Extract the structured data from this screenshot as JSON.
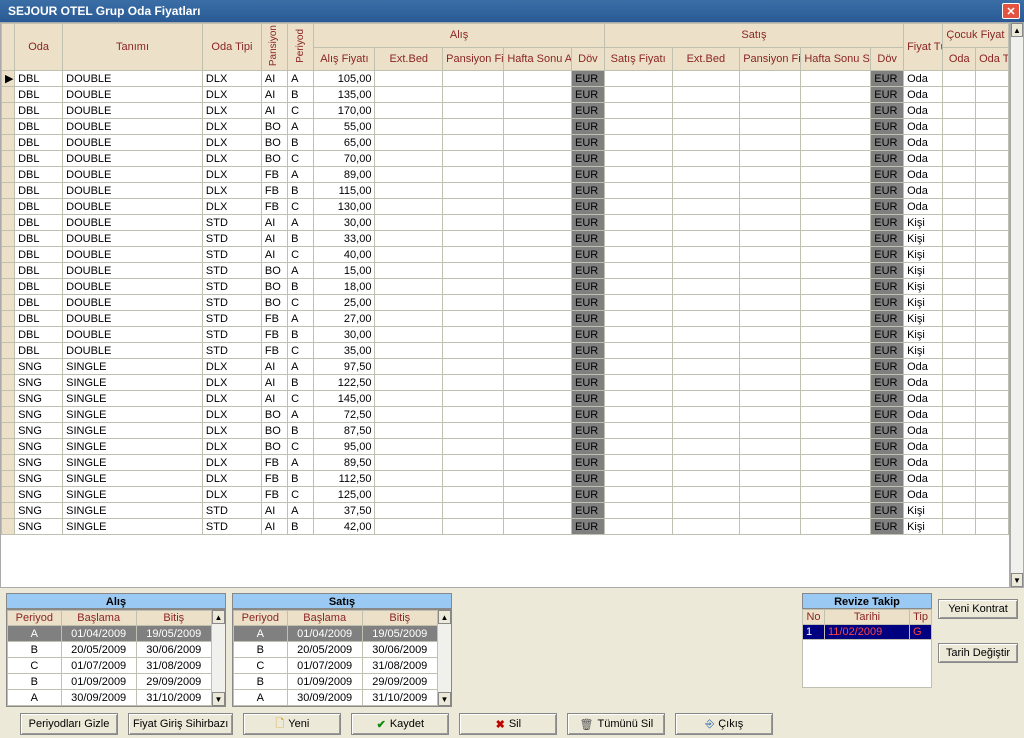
{
  "window": {
    "title": "SEJOUR OTEL   Grup Oda Fiyatları"
  },
  "grid": {
    "headers": {
      "oda": "Oda",
      "tanimi": "Tanımı",
      "oda_tipi": "Oda Tipi",
      "pansiyon": "Pansiyon",
      "periyod": "Periyod",
      "alis": "Alış",
      "satis": "Satış",
      "alis_fiyati": "Alış Fiyatı",
      "ext_bed": "Ext.Bed",
      "pansiyon_fiyati": "Pansiyon Fiyatı",
      "hafta_sonu_alis": "Hafta Sonu Alış Fiyatı",
      "dov": "Döv",
      "satis_fiyati": "Satış Fiyatı",
      "hafta_sonu_satis": "Hafta Sonu Satış Fiyatı",
      "fiyat_turu": "Fiyat Türü",
      "cocuk_ref": "Çocuk Fiyat Referans",
      "cocuk_oda": "Oda",
      "cocuk_oda_tipi": "Oda Tipi"
    },
    "rows": [
      {
        "oda": "DBL",
        "tanimi": "DOUBLE",
        "tipi": "DLX",
        "pan": "AI",
        "per": "A",
        "alis": "105,00",
        "dov": "EUR",
        "dov2": "EUR",
        "ft": "Oda"
      },
      {
        "oda": "DBL",
        "tanimi": "DOUBLE",
        "tipi": "DLX",
        "pan": "AI",
        "per": "B",
        "alis": "135,00",
        "dov": "EUR",
        "dov2": "EUR",
        "ft": "Oda"
      },
      {
        "oda": "DBL",
        "tanimi": "DOUBLE",
        "tipi": "DLX",
        "pan": "AI",
        "per": "C",
        "alis": "170,00",
        "dov": "EUR",
        "dov2": "EUR",
        "ft": "Oda"
      },
      {
        "oda": "DBL",
        "tanimi": "DOUBLE",
        "tipi": "DLX",
        "pan": "BO",
        "per": "A",
        "alis": "55,00",
        "dov": "EUR",
        "dov2": "EUR",
        "ft": "Oda"
      },
      {
        "oda": "DBL",
        "tanimi": "DOUBLE",
        "tipi": "DLX",
        "pan": "BO",
        "per": "B",
        "alis": "65,00",
        "dov": "EUR",
        "dov2": "EUR",
        "ft": "Oda"
      },
      {
        "oda": "DBL",
        "tanimi": "DOUBLE",
        "tipi": "DLX",
        "pan": "BO",
        "per": "C",
        "alis": "70,00",
        "dov": "EUR",
        "dov2": "EUR",
        "ft": "Oda"
      },
      {
        "oda": "DBL",
        "tanimi": "DOUBLE",
        "tipi": "DLX",
        "pan": "FB",
        "per": "A",
        "alis": "89,00",
        "dov": "EUR",
        "dov2": "EUR",
        "ft": "Oda"
      },
      {
        "oda": "DBL",
        "tanimi": "DOUBLE",
        "tipi": "DLX",
        "pan": "FB",
        "per": "B",
        "alis": "115,00",
        "dov": "EUR",
        "dov2": "EUR",
        "ft": "Oda"
      },
      {
        "oda": "DBL",
        "tanimi": "DOUBLE",
        "tipi": "DLX",
        "pan": "FB",
        "per": "C",
        "alis": "130,00",
        "dov": "EUR",
        "dov2": "EUR",
        "ft": "Oda"
      },
      {
        "oda": "DBL",
        "tanimi": "DOUBLE",
        "tipi": "STD",
        "pan": "AI",
        "per": "A",
        "alis": "30,00",
        "dov": "EUR",
        "dov2": "EUR",
        "ft": "Kişi"
      },
      {
        "oda": "DBL",
        "tanimi": "DOUBLE",
        "tipi": "STD",
        "pan": "AI",
        "per": "B",
        "alis": "33,00",
        "dov": "EUR",
        "dov2": "EUR",
        "ft": "Kişi"
      },
      {
        "oda": "DBL",
        "tanimi": "DOUBLE",
        "tipi": "STD",
        "pan": "AI",
        "per": "C",
        "alis": "40,00",
        "dov": "EUR",
        "dov2": "EUR",
        "ft": "Kişi"
      },
      {
        "oda": "DBL",
        "tanimi": "DOUBLE",
        "tipi": "STD",
        "pan": "BO",
        "per": "A",
        "alis": "15,00",
        "dov": "EUR",
        "dov2": "EUR",
        "ft": "Kişi"
      },
      {
        "oda": "DBL",
        "tanimi": "DOUBLE",
        "tipi": "STD",
        "pan": "BO",
        "per": "B",
        "alis": "18,00",
        "dov": "EUR",
        "dov2": "EUR",
        "ft": "Kişi"
      },
      {
        "oda": "DBL",
        "tanimi": "DOUBLE",
        "tipi": "STD",
        "pan": "BO",
        "per": "C",
        "alis": "25,00",
        "dov": "EUR",
        "dov2": "EUR",
        "ft": "Kişi"
      },
      {
        "oda": "DBL",
        "tanimi": "DOUBLE",
        "tipi": "STD",
        "pan": "FB",
        "per": "A",
        "alis": "27,00",
        "dov": "EUR",
        "dov2": "EUR",
        "ft": "Kişi"
      },
      {
        "oda": "DBL",
        "tanimi": "DOUBLE",
        "tipi": "STD",
        "pan": "FB",
        "per": "B",
        "alis": "30,00",
        "dov": "EUR",
        "dov2": "EUR",
        "ft": "Kişi"
      },
      {
        "oda": "DBL",
        "tanimi": "DOUBLE",
        "tipi": "STD",
        "pan": "FB",
        "per": "C",
        "alis": "35,00",
        "dov": "EUR",
        "dov2": "EUR",
        "ft": "Kişi"
      },
      {
        "oda": "SNG",
        "tanimi": "SINGLE",
        "tipi": "DLX",
        "pan": "AI",
        "per": "A",
        "alis": "97,50",
        "dov": "EUR",
        "dov2": "EUR",
        "ft": "Oda"
      },
      {
        "oda": "SNG",
        "tanimi": "SINGLE",
        "tipi": "DLX",
        "pan": "AI",
        "per": "B",
        "alis": "122,50",
        "dov": "EUR",
        "dov2": "EUR",
        "ft": "Oda"
      },
      {
        "oda": "SNG",
        "tanimi": "SINGLE",
        "tipi": "DLX",
        "pan": "AI",
        "per": "C",
        "alis": "145,00",
        "dov": "EUR",
        "dov2": "EUR",
        "ft": "Oda"
      },
      {
        "oda": "SNG",
        "tanimi": "SINGLE",
        "tipi": "DLX",
        "pan": "BO",
        "per": "A",
        "alis": "72,50",
        "dov": "EUR",
        "dov2": "EUR",
        "ft": "Oda"
      },
      {
        "oda": "SNG",
        "tanimi": "SINGLE",
        "tipi": "DLX",
        "pan": "BO",
        "per": "B",
        "alis": "87,50",
        "dov": "EUR",
        "dov2": "EUR",
        "ft": "Oda"
      },
      {
        "oda": "SNG",
        "tanimi": "SINGLE",
        "tipi": "DLX",
        "pan": "BO",
        "per": "C",
        "alis": "95,00",
        "dov": "EUR",
        "dov2": "EUR",
        "ft": "Oda"
      },
      {
        "oda": "SNG",
        "tanimi": "SINGLE",
        "tipi": "DLX",
        "pan": "FB",
        "per": "A",
        "alis": "89,50",
        "dov": "EUR",
        "dov2": "EUR",
        "ft": "Oda"
      },
      {
        "oda": "SNG",
        "tanimi": "SINGLE",
        "tipi": "DLX",
        "pan": "FB",
        "per": "B",
        "alis": "112,50",
        "dov": "EUR",
        "dov2": "EUR",
        "ft": "Oda"
      },
      {
        "oda": "SNG",
        "tanimi": "SINGLE",
        "tipi": "DLX",
        "pan": "FB",
        "per": "C",
        "alis": "125,00",
        "dov": "EUR",
        "dov2": "EUR",
        "ft": "Oda"
      },
      {
        "oda": "SNG",
        "tanimi": "SINGLE",
        "tipi": "STD",
        "pan": "AI",
        "per": "A",
        "alis": "37,50",
        "dov": "EUR",
        "dov2": "EUR",
        "ft": "Kişi"
      },
      {
        "oda": "SNG",
        "tanimi": "SINGLE",
        "tipi": "STD",
        "pan": "AI",
        "per": "B",
        "alis": "42,00",
        "dov": "EUR",
        "dov2": "EUR",
        "ft": "Kişi"
      }
    ]
  },
  "periods": {
    "alis_title": "Alış",
    "satis_title": "Satış",
    "headers": {
      "periyod": "Periyod",
      "baslama": "Başlama",
      "bitis": "Bitiş"
    },
    "rows": [
      {
        "p": "A",
        "b": "01/04/2009",
        "e": "19/05/2009",
        "sel": true
      },
      {
        "p": "B",
        "b": "20/05/2009",
        "e": "30/06/2009"
      },
      {
        "p": "C",
        "b": "01/07/2009",
        "e": "31/08/2009"
      },
      {
        "p": "B",
        "b": "01/09/2009",
        "e": "29/09/2009"
      },
      {
        "p": "A",
        "b": "30/09/2009",
        "e": "31/10/2009"
      }
    ]
  },
  "revize": {
    "title": "Revize Takip",
    "headers": {
      "no": "No",
      "tarihi": "Tarihi",
      "tip": "Tip"
    },
    "row": {
      "no": "1",
      "tarihi": "11/02/2009",
      "tip": "G"
    }
  },
  "buttons": {
    "yeni_kontrat": "Yeni Kontrat",
    "tarih_degistir": "Tarih Değiştir",
    "periyodlari_gizle": "Periyodları Gizle",
    "fiyat_giris": "Fiyat Giriş Sihirbazı",
    "yeni": "Yeni",
    "kaydet": "Kaydet",
    "sil": "Sil",
    "tumunu_sil": "Tümünü Sil",
    "cikis": "Çıkış"
  }
}
